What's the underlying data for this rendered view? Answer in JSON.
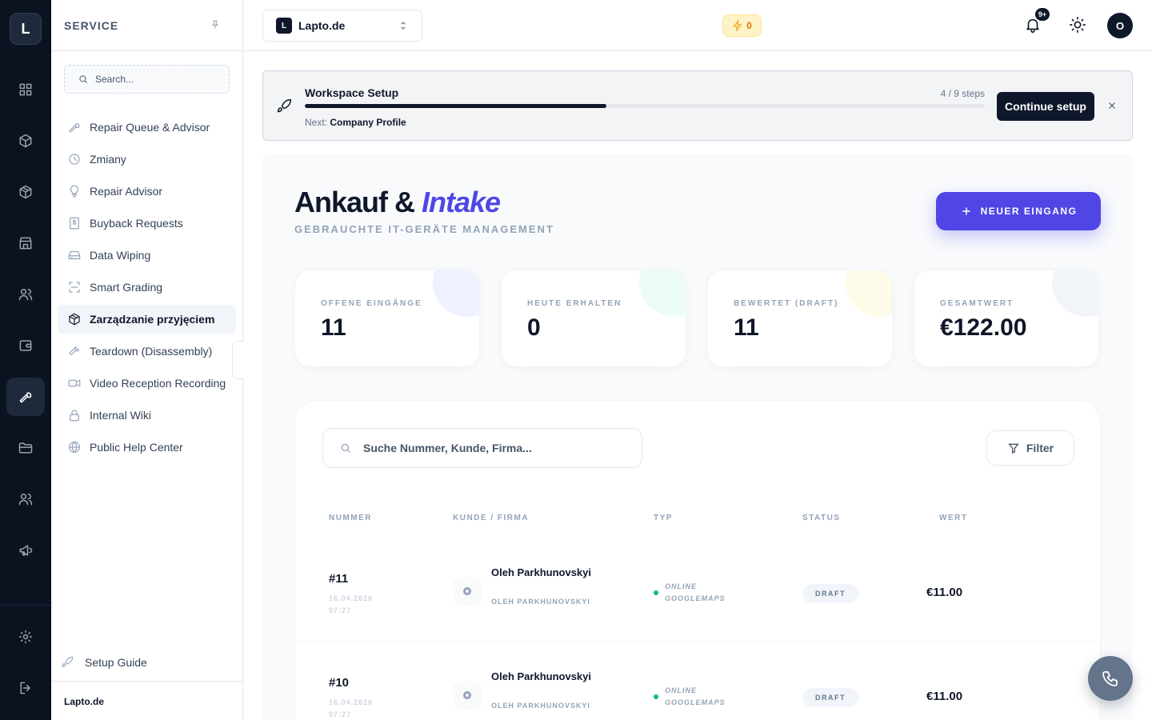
{
  "rail": {
    "logo": "L",
    "items": [
      {
        "icon": "dashboard-icon"
      },
      {
        "icon": "box-icon"
      },
      {
        "icon": "package-icon"
      },
      {
        "icon": "store-icon"
      },
      {
        "icon": "users-icon"
      },
      {
        "icon": "wallet-icon"
      },
      {
        "icon": "wrench-icon",
        "active": true
      },
      {
        "icon": "folder-icon"
      },
      {
        "icon": "team-icon"
      },
      {
        "icon": "megaphone-icon"
      },
      {
        "icon": "settings-icon"
      },
      {
        "icon": "logout-icon"
      }
    ]
  },
  "sidebar": {
    "title": "SERVICE",
    "search_placeholder": "Search...",
    "items": [
      {
        "label": "Repair Queue & Advisor",
        "icon": "wrench-icon"
      },
      {
        "label": "Zmiany",
        "icon": "clock-icon"
      },
      {
        "label": "Repair Advisor",
        "icon": "lightbulb-icon"
      },
      {
        "label": "Buyback Requests",
        "icon": "dollar-icon"
      },
      {
        "label": "Data Wiping",
        "icon": "hard-drive-icon"
      },
      {
        "label": "Smart Grading",
        "icon": "scan-icon"
      },
      {
        "label": "Zarządzanie przyjęciem",
        "icon": "package-check-icon",
        "active": true
      },
      {
        "label": "Teardown (Disassembly)",
        "icon": "hammer-icon"
      },
      {
        "label": "Video Reception Recording",
        "icon": "video-icon"
      },
      {
        "label": "Internal Wiki",
        "icon": "lock-icon"
      },
      {
        "label": "Public Help Center",
        "icon": "globe-icon"
      }
    ],
    "setup_guide": "Setup Guide",
    "footer": "Lapto.de"
  },
  "topbar": {
    "workspace_badge": "L",
    "workspace_name": "Lapto.de",
    "credits": "0",
    "notifications_badge": "9+",
    "avatar": "O"
  },
  "setup": {
    "title": "Workspace Setup",
    "steps": "4 / 9 steps",
    "progress": 0.444,
    "next_label": "Next:",
    "next_value": "Company Profile",
    "button": "Continue setup"
  },
  "page": {
    "title_main": "Ankauf &",
    "title_accent": "Intake",
    "subtitle": "GEBRAUCHTE IT-GERÄTE MANAGEMENT",
    "new_button": "NEUER EINGANG"
  },
  "stats": [
    {
      "label": "OFFENE EINGÄNGE",
      "value": "11",
      "deco": "#eef2ff"
    },
    {
      "label": "HEUTE ERHALTEN",
      "value": "0",
      "deco": "#ecfdf5"
    },
    {
      "label": "BEWERTET (DRAFT)",
      "value": "11",
      "deco": "#fefce8"
    },
    {
      "label": "GESAMTWERT",
      "value": "€122.00",
      "deco": "#f1f5f9"
    }
  ],
  "table": {
    "search_placeholder": "Suche Nummer, Kunde, Firma...",
    "filter": "Filter",
    "columns": [
      "NUMMER",
      "KUNDE / FIRMA",
      "TYP",
      "STATUS",
      "WERT"
    ],
    "rows": [
      {
        "number": "#11",
        "date": "16.04.2026",
        "time": "07:27",
        "name": "Oleh Parkhunovskyi",
        "company": "OLEH PARKHUNOVSKYI",
        "type": "ONLINE GOOGLEMAPS",
        "status": "DRAFT",
        "value": "€11.00"
      },
      {
        "number": "#10",
        "date": "16.04.2026",
        "time": "07:27",
        "name": "Oleh Parkhunovskyi",
        "company": "OLEH PARKHUNOVSKYI",
        "type": "ONLINE GOOGLEMAPS",
        "status": "DRAFT",
        "value": "€11.00"
      }
    ]
  }
}
